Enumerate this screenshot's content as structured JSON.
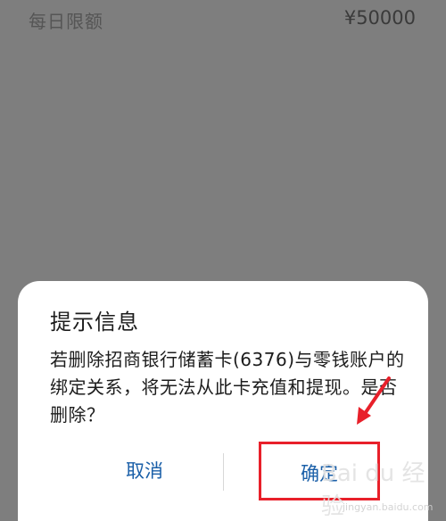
{
  "background": {
    "daily_limit_label": "每日限额",
    "daily_limit_value": "¥50000"
  },
  "dialog": {
    "title": "提示信息",
    "message": "若删除招商银行储蓄卡(6376)与零钱账户的绑定关系，将无法从此卡充值和提现。是否删除？",
    "cancel_label": "取消",
    "confirm_label": "确定"
  },
  "watermark": {
    "text": "Bai du 经验",
    "sub": "jingyan.baidu.com"
  },
  "colors": {
    "overlay": "#7e7e7e",
    "dialog_bg": "#ffffff",
    "button_text": "#1a5fa8",
    "highlight": "#e8202a"
  }
}
